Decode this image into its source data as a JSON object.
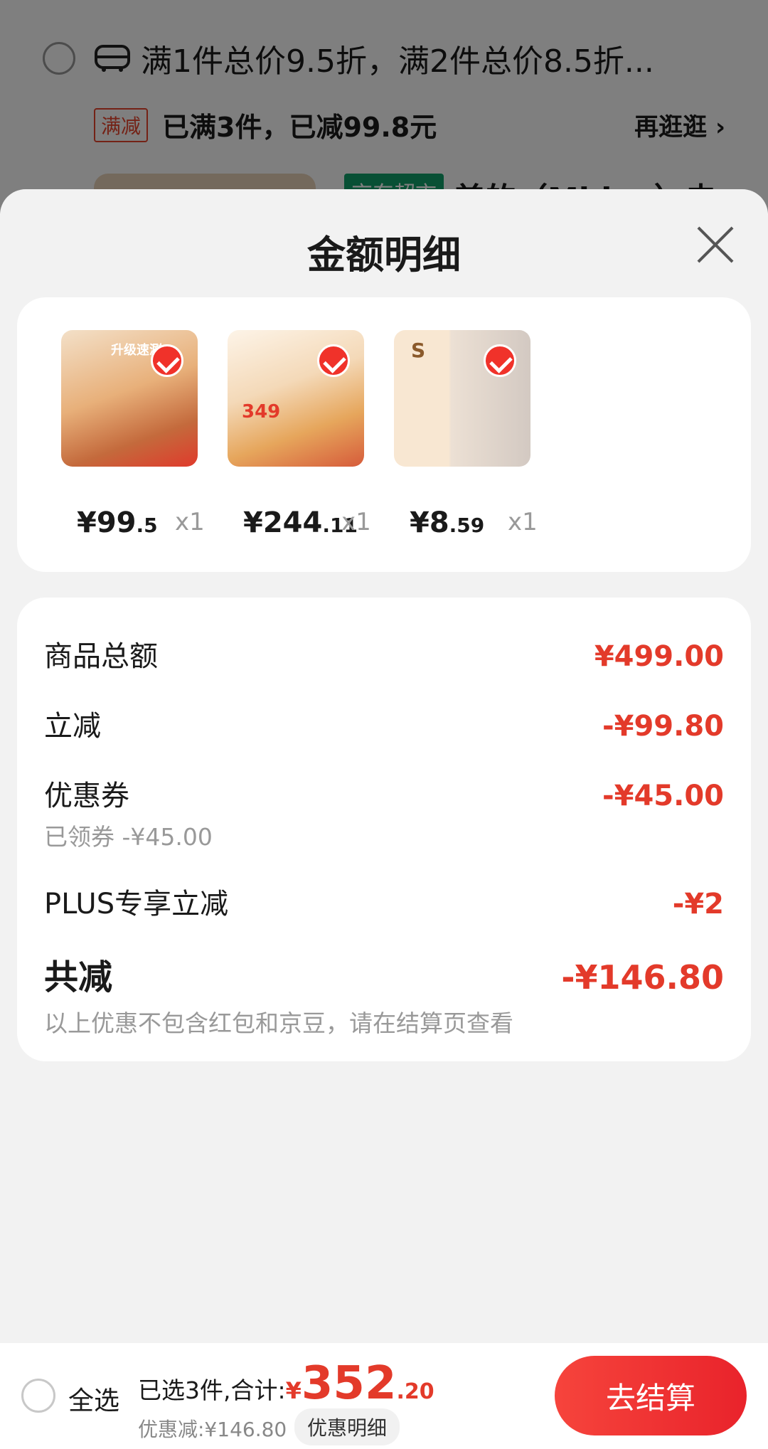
{
  "background": {
    "promo_text": "满1件总价9.5折，满2件总价8.5折...",
    "tag": "满减",
    "reached": "已满3件，已减99.8元",
    "more": "再逛逛 ›",
    "store_tag": "京东超市",
    "item_title": "美的（Midea）电火"
  },
  "modal": {
    "title": "金额明细",
    "products": [
      {
        "price_int": "¥99",
        "price_dec": ".5",
        "qty": "x1",
        "img_text": "升级速涮"
      },
      {
        "price_int": "¥244",
        "price_dec": ".11",
        "qty": "x1",
        "img_text": "349"
      },
      {
        "price_int": "¥8",
        "price_dec": ".59",
        "qty": "x1",
        "img_text": "S"
      }
    ],
    "lines": {
      "total_label": "商品总额",
      "total_value": "¥499.00",
      "instant_label": "立减",
      "instant_value": "-¥99.80",
      "coupon_label": "优惠券",
      "coupon_value": "-¥45.00",
      "coupon_sub": "已领券 -¥45.00",
      "plus_label": "PLUS专享立减",
      "plus_value": "-¥2",
      "saved_label": "共减",
      "saved_value": "-¥146.80",
      "saved_note": "以上优惠不包含红包和京豆，请在结算页查看"
    }
  },
  "bottom": {
    "select_all": "全选",
    "selected_text": "已选3件,合计:",
    "yen": "¥",
    "total_int": "352",
    "total_dec": ".20",
    "discount": "优惠减:¥146.80",
    "detail_button": "优惠明细",
    "checkout": "去结算"
  },
  "colors": {
    "accent": "#e33a2a",
    "checkout": "#f0322a"
  }
}
